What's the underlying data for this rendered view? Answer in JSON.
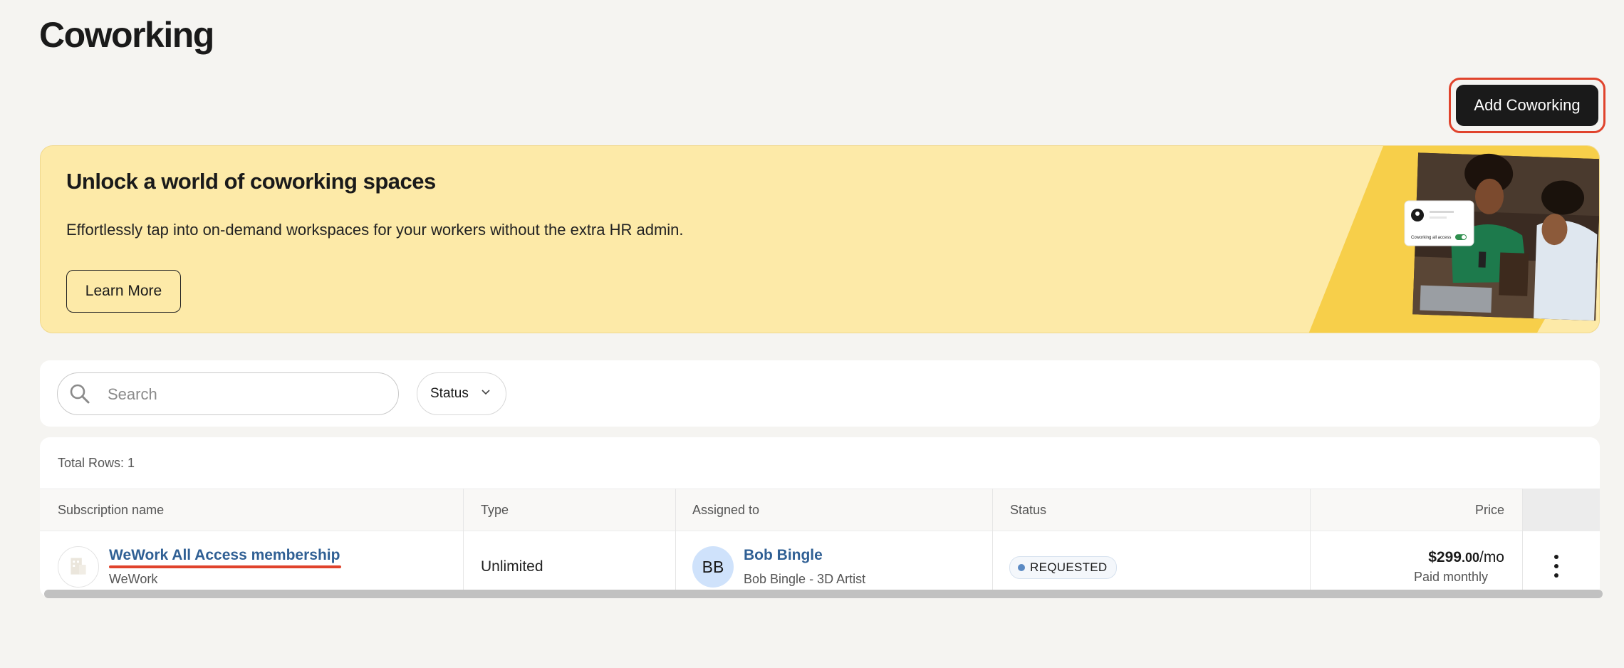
{
  "page": {
    "title": "Coworking"
  },
  "header": {
    "add_button_label": "Add Coworking"
  },
  "banner": {
    "title": "Unlock a world of coworking spaces",
    "description": "Effortlessly tap into on-demand workspaces for your workers without the extra HR admin.",
    "learn_more_label": "Learn More",
    "illustration_card_label": "Coworking all access"
  },
  "filters": {
    "search_placeholder": "Search",
    "status_label": "Status"
  },
  "table": {
    "total_rows_text": "Total Rows: 1",
    "columns": [
      "Subscription name",
      "Type",
      "Assigned to",
      "Status",
      "Price"
    ],
    "rows": [
      {
        "subscription_name": "WeWork All Access membership",
        "vendor": "WeWork",
        "type": "Unlimited",
        "assignee_initials": "BB",
        "assignee_name": "Bob Bingle",
        "assignee_role": "Bob Bingle - 3D Artist",
        "status": "REQUESTED",
        "price_amount": "$299",
        "price_cents": ".00",
        "price_period": "/mo",
        "billing": "Paid monthly"
      }
    ]
  },
  "colors": {
    "accent_red": "#e0432c",
    "banner_bg": "#fdeaa8",
    "link_blue": "#2f5f94",
    "status_dot": "#5b8ac3"
  }
}
